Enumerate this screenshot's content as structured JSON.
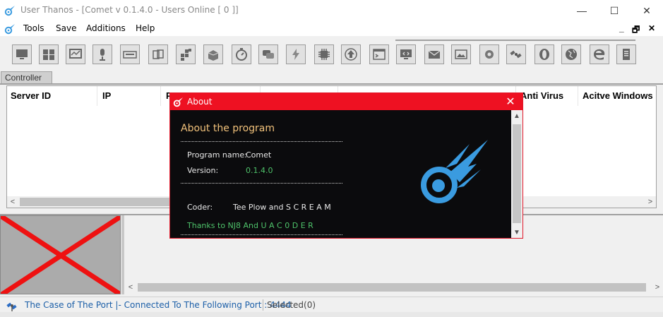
{
  "window": {
    "title": "User Thanos - [Comet v 0.1.4.0 - Users Online [ 0 ]]",
    "minimize": "—",
    "maximize": "☐",
    "close": "✕"
  },
  "menu": {
    "items": [
      "Tools",
      "Save",
      "Additions",
      "Help"
    ],
    "mdi_controls": [
      "_",
      "🗗",
      "✕"
    ]
  },
  "toolbar": {
    "buttons": [
      "monitor-icon",
      "windows-icon",
      "task-manager-icon",
      "microphone-icon",
      "keyboard-icon",
      "file-manager-icon",
      "registry-icon",
      "package-icon",
      "stopwatch-icon",
      "chat-icon",
      "power-icon",
      "cpu-icon",
      "upload-icon",
      "script-icon",
      "remote-desktop-icon",
      "mail-icon",
      "image-icon",
      "settings-icon",
      "satellite-icon",
      "opera-icon",
      "globe-icon",
      "edge-icon",
      "server-icon"
    ]
  },
  "tabs": {
    "controller": "Controller"
  },
  "grid": {
    "columns": [
      "Server ID",
      "IP",
      "P",
      "",
      "",
      "Anti Virus",
      "Acitve Windows"
    ]
  },
  "statusbar": {
    "port_text": "The Case of The Port |- Connected To The Following Port : 4444",
    "selected": "Selected(0)"
  },
  "about_dialog": {
    "title": "About",
    "close": "✕",
    "heading": "About the program",
    "program_name_label": "Program name:",
    "program_name_value": "Comet",
    "version_label": "Version:",
    "version_value": "0.1.4.0",
    "coder_label": "Coder:",
    "coder_value": "Tee Plow and S C R E A M",
    "thanks": "Thanks to NJ8  And  U A C 0 D E R"
  },
  "colors": {
    "accent_red": "#ee1122",
    "dialog_bg": "#0b0b0d",
    "heading_gold": "#f2c27b",
    "value_green": "#4ec26a",
    "logo_blue": "#3a9be0",
    "status_blue": "#1c5fa8"
  }
}
